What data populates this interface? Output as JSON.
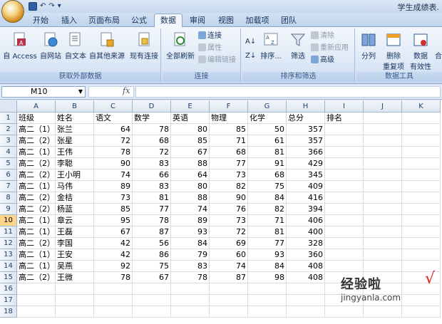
{
  "title_bar": {
    "doc_title": "学生成绩表."
  },
  "quick_access": {
    "undo": "↶",
    "redo": "↷",
    "more": "▾"
  },
  "tabs": [
    {
      "label": "开始"
    },
    {
      "label": "插入"
    },
    {
      "label": "页面布局"
    },
    {
      "label": "公式"
    },
    {
      "label": "数据"
    },
    {
      "label": "审阅"
    },
    {
      "label": "视图"
    },
    {
      "label": "加载项"
    },
    {
      "label": "团队"
    }
  ],
  "active_tab": "数据",
  "ribbon": {
    "group1": {
      "label": "获取外部数据",
      "from_access": "自 Access",
      "from_web": "自网站",
      "from_text": "自文本",
      "from_other": "自其他来源",
      "existing": "现有连接"
    },
    "group2": {
      "label": "连接",
      "refresh_all": "全部刷新",
      "connections": "连接",
      "properties": "属性",
      "edit_links": "编辑链接"
    },
    "group3": {
      "label": "排序和筛选",
      "sort": "排序...",
      "filter": "筛选",
      "clear": "清除",
      "reapply": "重新应用",
      "advanced": "高级"
    },
    "group4": {
      "label": "数据工具",
      "text_to_columns": "分列",
      "remove_dup_1": "删除",
      "remove_dup_2": "重复项",
      "validation_1": "数据",
      "validation_2": "有效性",
      "consolidate": "合"
    }
  },
  "formula_bar": {
    "name_box": "M10",
    "fx": "fx",
    "formula": ""
  },
  "columns": [
    "A",
    "B",
    "C",
    "D",
    "E",
    "F",
    "G",
    "H",
    "I",
    "J",
    "K"
  ],
  "rows": [
    "1",
    "2",
    "3",
    "4",
    "5",
    "6",
    "7",
    "8",
    "9",
    "10",
    "11",
    "12",
    "13",
    "14",
    "15",
    "16",
    "17",
    "18"
  ],
  "selected_row": "10",
  "header_row": [
    "班级",
    "姓名",
    "语文",
    "数学",
    "英语",
    "物理",
    "化学",
    "总分",
    "排名"
  ],
  "table": [
    [
      "高二（1）",
      "张兰",
      "64",
      "78",
      "80",
      "85",
      "50",
      "357"
    ],
    [
      "高二（2）",
      "张星",
      "72",
      "68",
      "85",
      "71",
      "61",
      "357"
    ],
    [
      "高二（1）",
      "王伟",
      "78",
      "72",
      "67",
      "68",
      "81",
      "366"
    ],
    [
      "高二（2）",
      "李聪",
      "90",
      "83",
      "88",
      "77",
      "91",
      "429"
    ],
    [
      "高二（2）",
      "王小明",
      "74",
      "66",
      "64",
      "73",
      "68",
      "345"
    ],
    [
      "高二（1）",
      "马伟",
      "89",
      "83",
      "80",
      "82",
      "75",
      "409"
    ],
    [
      "高二（2）",
      "金桔",
      "73",
      "81",
      "88",
      "90",
      "84",
      "416"
    ],
    [
      "高二（2）",
      "杨蓝",
      "85",
      "77",
      "74",
      "76",
      "82",
      "394"
    ],
    [
      "高二（1）",
      "章云",
      "95",
      "78",
      "89",
      "73",
      "71",
      "406"
    ],
    [
      "高二（1）",
      "王磊",
      "67",
      "87",
      "93",
      "72",
      "81",
      "400"
    ],
    [
      "高二（2）",
      "李国",
      "42",
      "56",
      "84",
      "69",
      "77",
      "328"
    ],
    [
      "高二（1）",
      "王安",
      "42",
      "86",
      "79",
      "60",
      "93",
      "360"
    ],
    [
      "高二（1）",
      "吴燕",
      "92",
      "75",
      "83",
      "74",
      "84",
      "408"
    ],
    [
      "高二（2）",
      "王微",
      "78",
      "67",
      "78",
      "87",
      "98",
      "408"
    ]
  ],
  "watermark": {
    "line1": "经验啦",
    "check": "√",
    "line2": "jingyanla.com"
  }
}
